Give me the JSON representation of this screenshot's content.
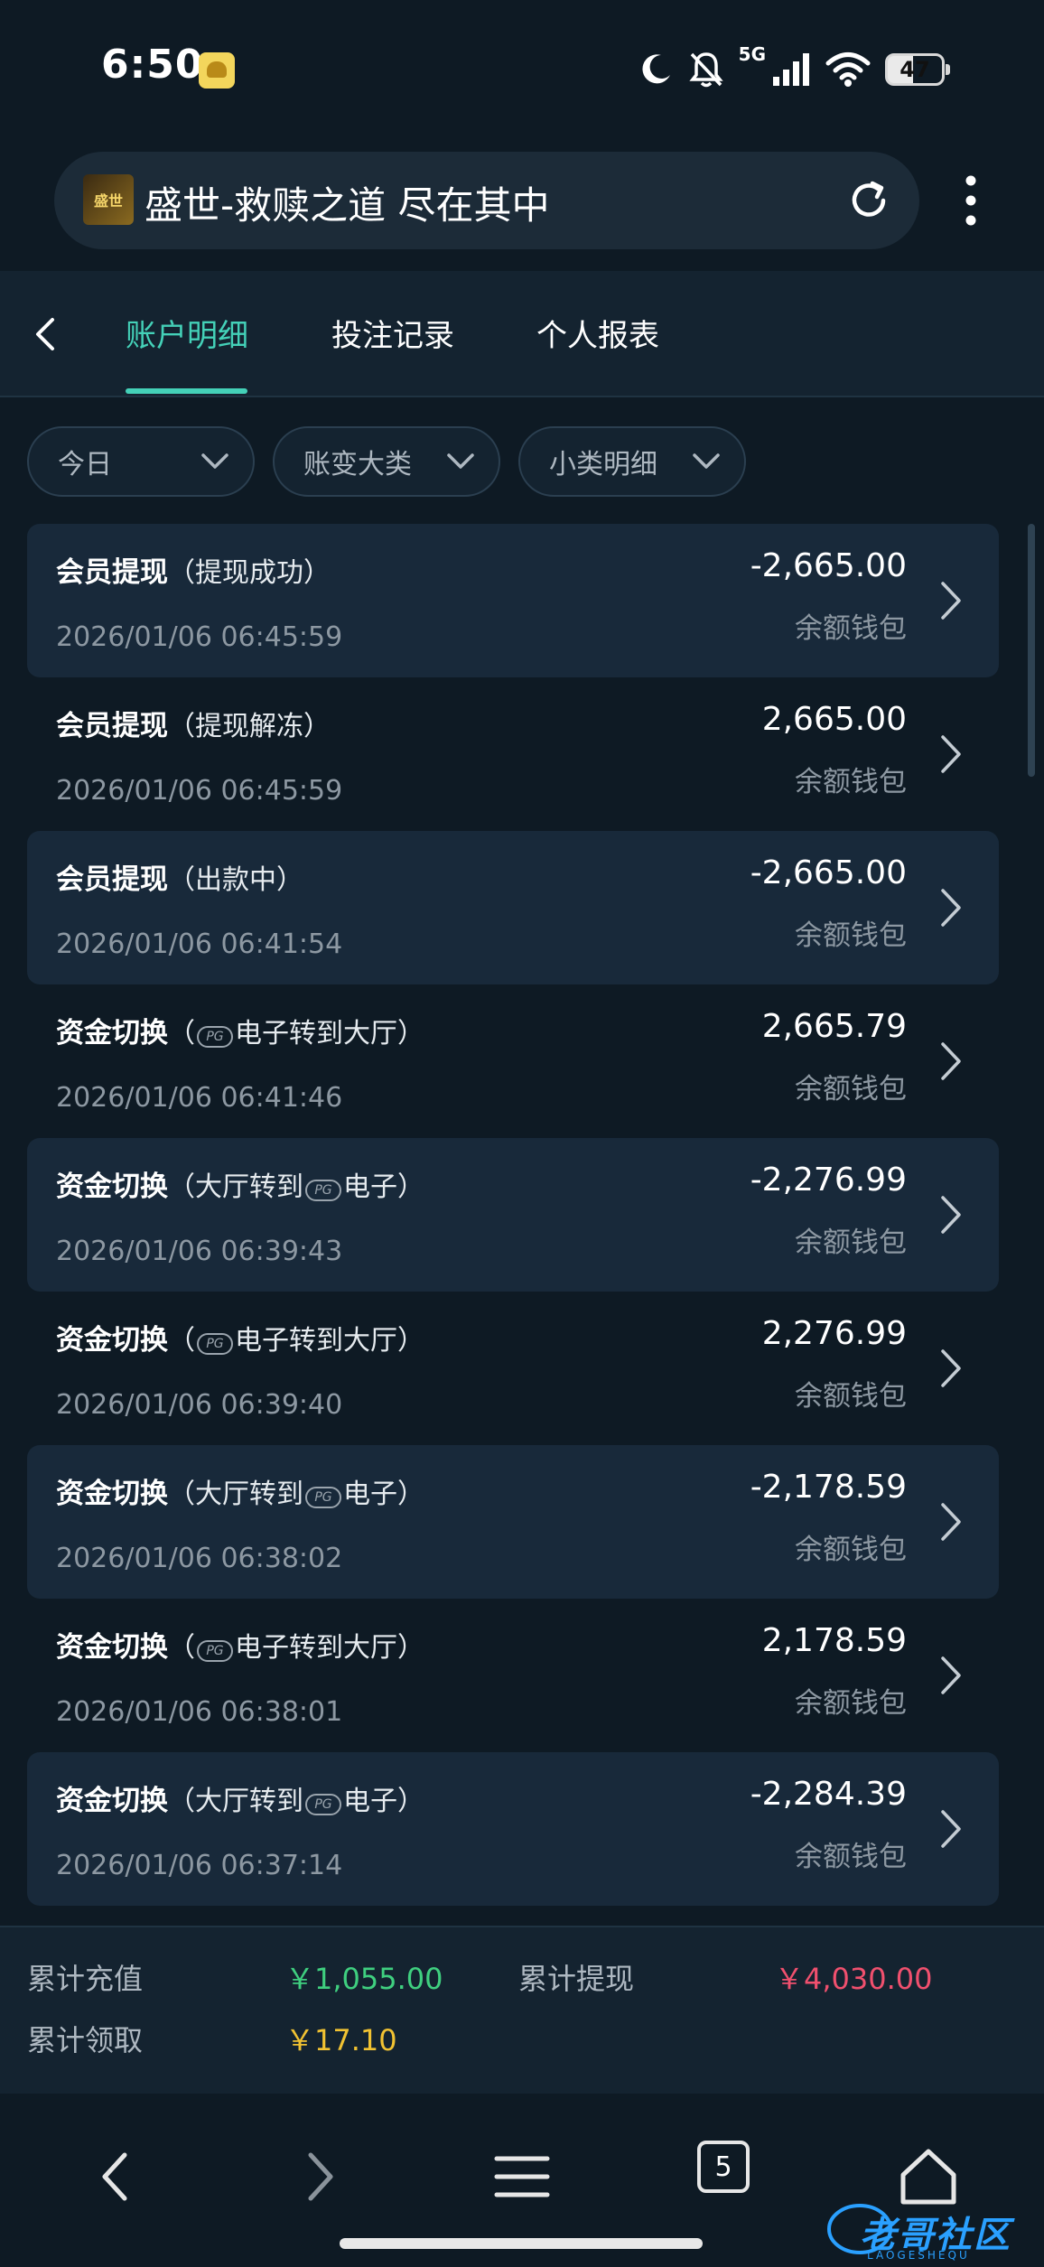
{
  "status_bar": {
    "time": "6:50",
    "network": "5G",
    "battery": "47",
    "icons": [
      "app-notification-icon",
      "moon-icon",
      "bell-off-icon",
      "signal-icon",
      "wifi-icon",
      "battery-icon"
    ]
  },
  "browser": {
    "site_title": "盛世-救赎之道 尽在其中",
    "site_logo_text": "盛世",
    "tab_count": "5"
  },
  "tabs": [
    {
      "label": "账户明细",
      "active": true
    },
    {
      "label": "投注记录",
      "active": false
    },
    {
      "label": "个人报表",
      "active": false
    }
  ],
  "filters": [
    {
      "label": "今日"
    },
    {
      "label": "账变大类"
    },
    {
      "label": "小类明细"
    }
  ],
  "transactions": [
    {
      "type": "会员提现",
      "detail": "（提现成功）",
      "time": "2026/01/06 06:45:59",
      "amount": "-2,665.00",
      "wallet": "余额钱包"
    },
    {
      "type": "会员提现",
      "detail": "（提现解冻）",
      "time": "2026/01/06 06:45:59",
      "amount": "2,665.00",
      "wallet": "余额钱包"
    },
    {
      "type": "会员提现",
      "detail": "（出款中）",
      "time": "2026/01/06 06:41:54",
      "amount": "-2,665.00",
      "wallet": "余额钱包"
    },
    {
      "type": "资金切换",
      "detail_pre": "（",
      "detail_post": "电子转到大厅）",
      "time": "2026/01/06 06:41:46",
      "amount": "2,665.79",
      "wallet": "余额钱包"
    },
    {
      "type": "资金切换",
      "detail_pre": "（大厅转到",
      "detail_post": "电子）",
      "time": "2026/01/06 06:39:43",
      "amount": "-2,276.99",
      "wallet": "余额钱包"
    },
    {
      "type": "资金切换",
      "detail_pre": "（",
      "detail_post": "电子转到大厅）",
      "time": "2026/01/06 06:39:40",
      "amount": "2,276.99",
      "wallet": "余额钱包"
    },
    {
      "type": "资金切换",
      "detail_pre": "（大厅转到",
      "detail_post": "电子）",
      "time": "2026/01/06 06:38:02",
      "amount": "-2,178.59",
      "wallet": "余额钱包"
    },
    {
      "type": "资金切换",
      "detail_pre": "（",
      "detail_post": "电子转到大厅）",
      "time": "2026/01/06 06:38:01",
      "amount": "2,178.59",
      "wallet": "余额钱包"
    },
    {
      "type": "资金切换",
      "detail_pre": "（大厅转到",
      "detail_post": "电子）",
      "time": "2026/01/06 06:37:14",
      "amount": "-2,284.39",
      "wallet": "余额钱包"
    }
  ],
  "summary": {
    "recharge_label": "累计充值",
    "recharge_value": "￥1,055.00",
    "withdraw_label": "累计提现",
    "withdraw_value": "￥4,030.00",
    "claim_label": "累计领取",
    "claim_value": "￥17.10"
  },
  "watermark": {
    "text": "老哥社区",
    "sub": "LAOGESHEQU"
  },
  "colors": {
    "accent": "#44d1b8",
    "positive": "#3fcf7f",
    "negative": "#f0506e",
    "highlight": "#f1c232",
    "background": "#0e1a24"
  }
}
